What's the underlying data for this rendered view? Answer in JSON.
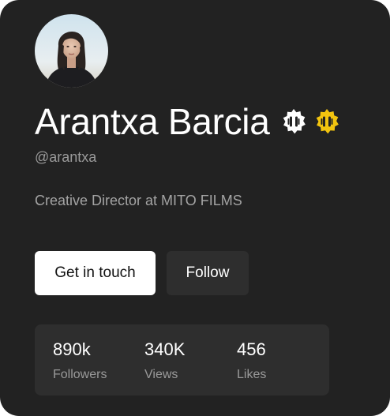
{
  "profile": {
    "name": "Arantxa Barcia",
    "handle": "@arantxa",
    "bio": "Creative Director at MITO FILMS",
    "avatar_alt": "profile-photo"
  },
  "badges": [
    {
      "icon": "verified-badge-icon",
      "color": "#ffffff"
    },
    {
      "icon": "verified-badge-icon",
      "color": "#f2c40f"
    }
  ],
  "actions": {
    "primary_label": "Get in touch",
    "secondary_label": "Follow"
  },
  "stats": [
    {
      "value": "890k",
      "label": "Followers"
    },
    {
      "value": "340K",
      "label": "Views"
    },
    {
      "value": "456",
      "label": "Likes"
    }
  ],
  "colors": {
    "card_bg": "#222222",
    "surface": "#2e2e2e",
    "muted_text": "#9a9a9a",
    "accent_gold": "#f2c40f"
  }
}
